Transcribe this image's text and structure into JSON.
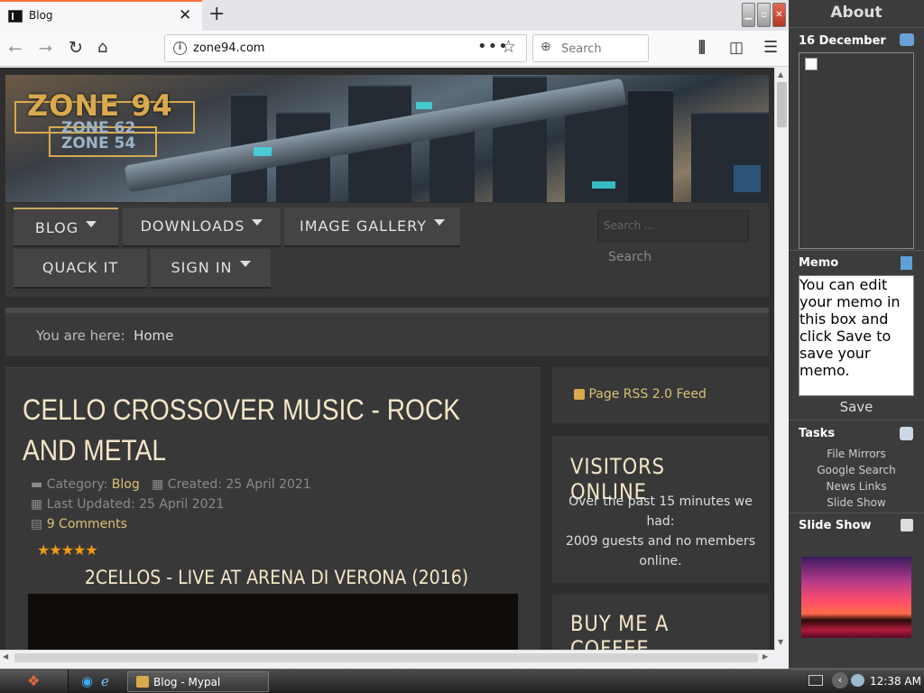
{
  "browser": {
    "tab_title": "Blog",
    "url": "zone94.com",
    "search_placeholder": "Search",
    "minimize_glyph": "▁",
    "maximize_glyph": "▫",
    "close_glyph": "✕"
  },
  "site": {
    "logo_main": "ZONE 94",
    "logo_sub1": "ZONE 62",
    "logo_sub2": "ZONE 54",
    "menu": [
      {
        "label": "BLOG",
        "dropdown": true
      },
      {
        "label": "DOWNLOADS",
        "dropdown": true
      },
      {
        "label": "IMAGE GALLERY",
        "dropdown": true
      },
      {
        "label": "QUACK IT",
        "dropdown": false
      },
      {
        "label": "SIGN IN",
        "dropdown": true
      }
    ],
    "search_placeholder": "Search ...",
    "search_button": "Search",
    "breadcrumb_prefix": "You are here:",
    "breadcrumb_current": "Home"
  },
  "article": {
    "title": "CELLO CROSSOVER MUSIC - ROCK AND METAL",
    "category_label": "Category:",
    "category_value": "Blog",
    "created": "Created: 25 April 2021",
    "updated": "Last Updated: 25 April 2021",
    "comments": "9 Comments",
    "rating": 5,
    "video_title": "2CELLOS - LIVE AT ARENA DI VERONA (2016)"
  },
  "sidebar_modules": {
    "rss": "Page RSS 2.0 Feed",
    "visitors_title": "VISITORS ONLINE",
    "visitors_text": "Over the past 15 minutes we had:",
    "visitors_count": "2009 guests and no members online.",
    "coffee_title": "BUY ME A COFFEE"
  },
  "desktop_sidebar": {
    "title": "About",
    "date": "16 December",
    "memo_title": "Memo",
    "memo_text": "You can edit your memo in this box and click Save to save your memo.",
    "memo_save": "Save",
    "tasks_title": "Tasks",
    "tasks": [
      "File Mirrors",
      "Google Search",
      "News Links",
      "Slide Show"
    ],
    "slideshow_title": "Slide Show"
  },
  "taskbar": {
    "window_label": "Blog - Mypal",
    "clock": "12:38 AM"
  }
}
